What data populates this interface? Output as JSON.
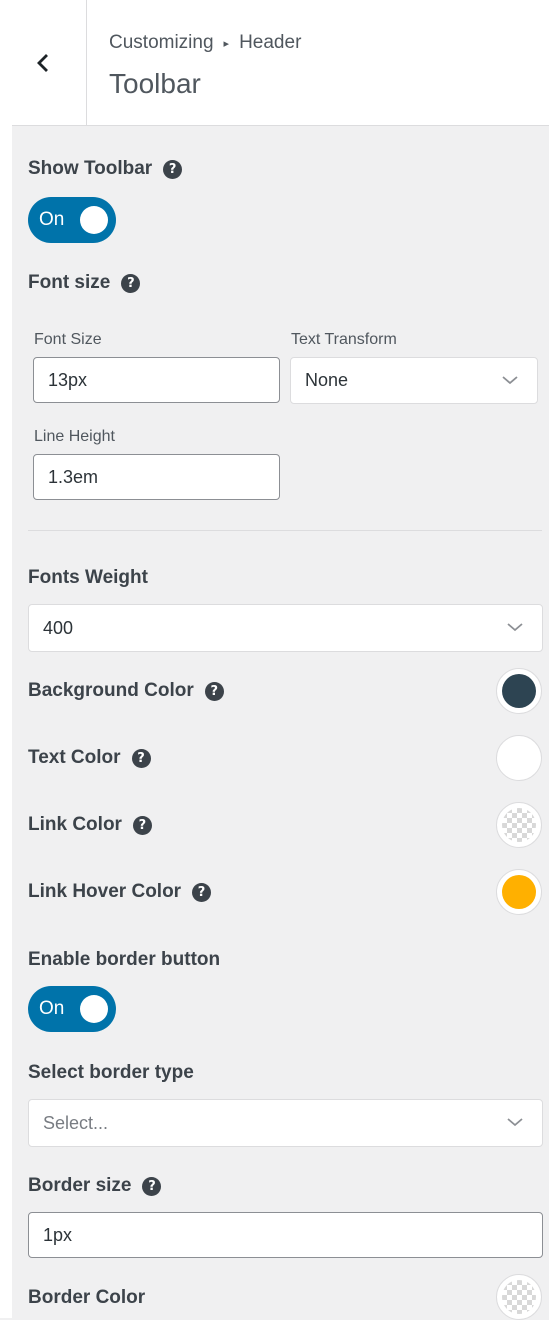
{
  "header": {
    "breadcrumb_root": "Customizing",
    "breadcrumb_section": "Header",
    "title": "Toolbar",
    "back_icon": "chevron-left-icon"
  },
  "show_toolbar": {
    "label": "Show Toolbar",
    "help": "?",
    "toggle_text": "On"
  },
  "font_size": {
    "label": "Font size",
    "help": "?",
    "font_size_label": "Font Size",
    "font_size_value": "13px",
    "text_transform_label": "Text Transform",
    "text_transform_value": "None",
    "line_height_label": "Line Height",
    "line_height_value": "1.3em"
  },
  "fonts_weight": {
    "label": "Fonts Weight",
    "value": "400"
  },
  "colors": {
    "background": {
      "label": "Background Color",
      "help": "?",
      "value": "#2d4452"
    },
    "text": {
      "label": "Text Color",
      "help": "?",
      "value": "#ffffff"
    },
    "link": {
      "label": "Link Color",
      "help": "?",
      "value": "transparent"
    },
    "link_hover": {
      "label": "Link Hover Color",
      "help": "?",
      "value": "#ffb000"
    }
  },
  "enable_border": {
    "label": "Enable border button",
    "toggle_text": "On"
  },
  "border_type": {
    "label": "Select border type",
    "placeholder": "Select..."
  },
  "border_size": {
    "label": "Border size",
    "help": "?",
    "value": "1px"
  },
  "border_color": {
    "label": "Border Color",
    "value": "transparent"
  },
  "accent_color": "#0073aa"
}
